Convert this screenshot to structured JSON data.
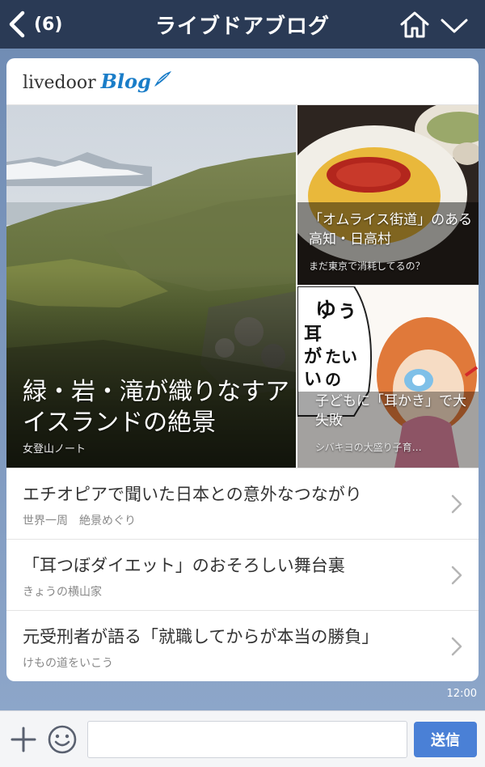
{
  "header": {
    "back_count": "(6)",
    "title": "ライブドアブログ",
    "icons": {
      "back": "chevron-left-icon",
      "home": "home-icon",
      "menu": "chevron-down-icon"
    }
  },
  "card": {
    "brand": {
      "livedoor": "livedoor",
      "blog": "Blog"
    },
    "hero": {
      "main": {
        "title": "緑・岩・滝が織りなすアイスランドの絶景",
        "source": "女登山ノート"
      },
      "side_top": {
        "title": "「オムライス街道」のある高知・日高村",
        "source": "まだ東京で消耗してるの？"
      },
      "side_bottom": {
        "title": "子どもに「耳かき」で大失敗",
        "source": "シバキヨの大盛り子育…",
        "illustration_text": "ゆぅ耳がいたいの"
      }
    },
    "list": [
      {
        "title": "エチオピアで聞いた日本との意外なつながり",
        "source": "世界一周　絶景めぐり"
      },
      {
        "title": "「耳つぼダイエット」のおそろしい舞台裏",
        "source": "きょうの横山家"
      },
      {
        "title": "元受刑者が語る「就職してからが本当の勝負」",
        "source": "けもの道をいこう"
      }
    ]
  },
  "timestamp": "12:00",
  "input_bar": {
    "placeholder": "",
    "send_label": "送信",
    "icons": {
      "plus": "plus-icon",
      "emoji": "emoji-icon"
    }
  },
  "colors": {
    "header_bg": "#2a3a55",
    "send_button": "#4a80d6",
    "brand_blue": "#1a7dc8"
  }
}
